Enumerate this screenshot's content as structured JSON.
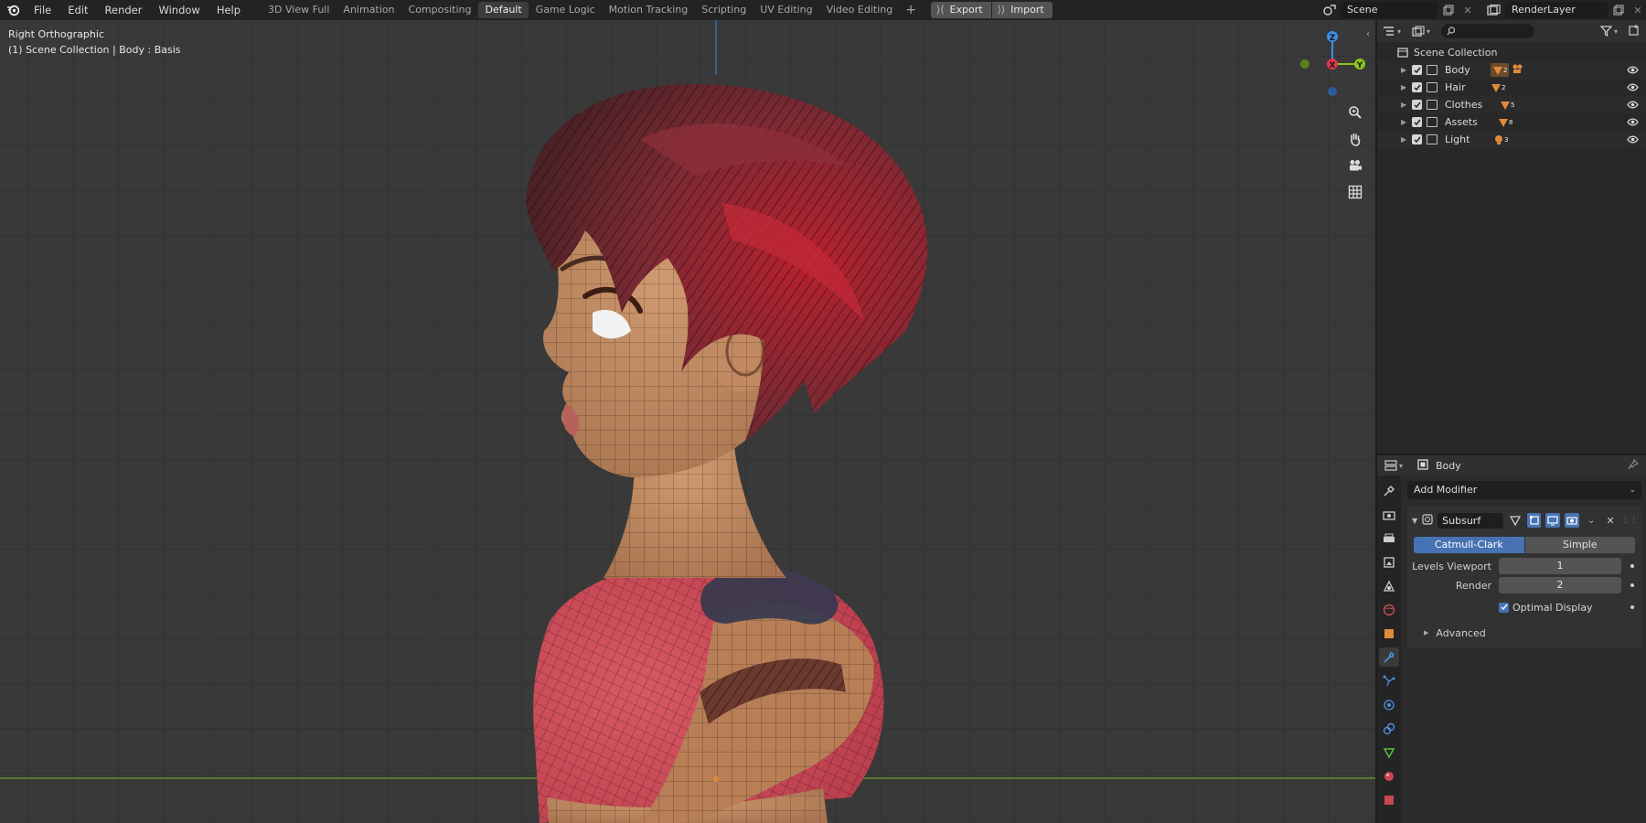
{
  "topbar": {
    "menus": [
      "File",
      "Edit",
      "Render",
      "Window",
      "Help"
    ],
    "workspaces": [
      "3D View Full",
      "Animation",
      "Compositing",
      "Default",
      "Game Logic",
      "Motion Tracking",
      "Scripting",
      "UV Editing",
      "Video Editing"
    ],
    "active_workspace": "Default",
    "export_label": "Export",
    "import_label": "Import",
    "scene_name": "Scene",
    "view_layer_name": "RenderLayer"
  },
  "viewport": {
    "view_name": "Right Orthographic",
    "context": "(1) Scene Collection | Body : Basis",
    "gizmo_axes": [
      "Z",
      "X",
      "Y"
    ]
  },
  "outliner": {
    "root": "Scene Collection",
    "collections": [
      {
        "name": "Body",
        "badge": "2"
      },
      {
        "name": "Hair",
        "badge": "2"
      },
      {
        "name": "Clothes",
        "badge": "5"
      },
      {
        "name": "Assets",
        "badge": "8"
      },
      {
        "name": "Light",
        "badge": "3"
      }
    ]
  },
  "properties": {
    "object_name": "Body",
    "add_modifier_label": "Add Modifier",
    "modifier": {
      "name": "Subsurf",
      "algorithm_options": [
        "Catmull-Clark",
        "Simple"
      ],
      "active_algorithm": "Catmull-Clark",
      "levels_viewport_label": "Levels Viewport",
      "levels_viewport": "1",
      "render_label": "Render",
      "render_levels": "2",
      "optimal_display_label": "Optimal Display",
      "optimal_display": true,
      "advanced_label": "Advanced"
    }
  },
  "colors": {
    "accent_blue": "#4772b3",
    "axis_x": "#e2364f",
    "axis_y": "#8bc41e",
    "axis_z": "#3b8fe5",
    "highlight_orange": "#e18a3c"
  }
}
